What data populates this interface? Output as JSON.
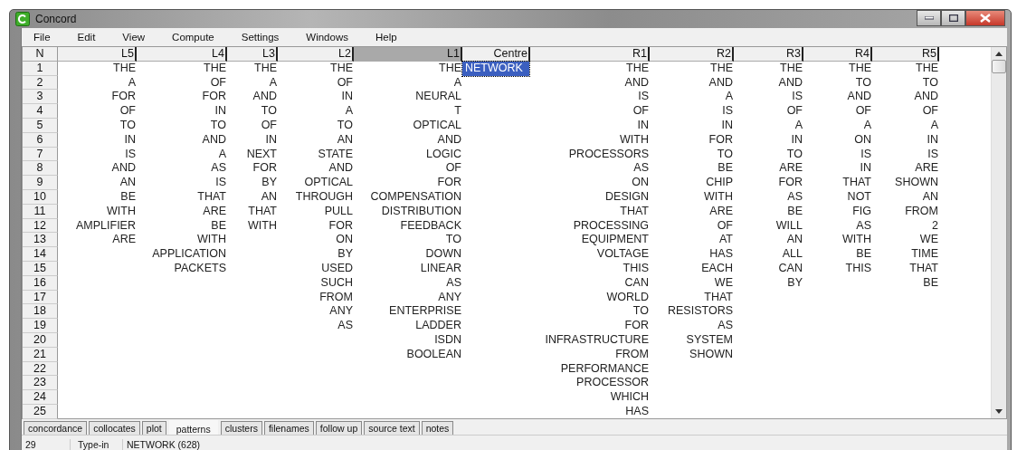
{
  "window": {
    "title": "Concord"
  },
  "menu": [
    "File",
    "Edit",
    "View",
    "Compute",
    "Settings",
    "Windows",
    "Help"
  ],
  "table": {
    "row_header": "N",
    "row_numbers": [
      "1",
      "2",
      "3",
      "4",
      "5",
      "6",
      "7",
      "8",
      "9",
      "10",
      "11",
      "12",
      "13",
      "14",
      "15",
      "16",
      "17",
      "18",
      "19",
      "20",
      "21",
      "22",
      "23",
      "24",
      "25"
    ],
    "columns": [
      {
        "label": "L5",
        "selected": false,
        "words": [
          "THE",
          "A",
          "FOR",
          "OF",
          "TO",
          "IN",
          "IS",
          "AND",
          "AN",
          "BE",
          "WITH",
          "AMPLIFIER",
          "ARE"
        ]
      },
      {
        "label": "L4",
        "selected": false,
        "words": [
          "THE",
          "OF",
          "FOR",
          "IN",
          "TO",
          "AND",
          "A",
          "AS",
          "IS",
          "THAT",
          "ARE",
          "BE",
          "WITH",
          "APPLICATION",
          "PACKETS"
        ]
      },
      {
        "label": "L3",
        "selected": false,
        "words": [
          "THE",
          "A",
          "AND",
          "TO",
          "OF",
          "IN",
          "NEXT",
          "FOR",
          "BY",
          "AN",
          "THAT",
          "WITH"
        ]
      },
      {
        "label": "L2",
        "selected": false,
        "words": [
          "THE",
          "OF",
          "IN",
          "A",
          "TO",
          "AN",
          "STATE",
          "AND",
          "OPTICAL",
          "THROUGH",
          "PULL",
          "FOR",
          "ON",
          "BY",
          "USED",
          "SUCH",
          "FROM",
          "ANY",
          "AS"
        ]
      },
      {
        "label": "L1",
        "selected": true,
        "words": [
          "THE",
          "A",
          "NEURAL",
          "T",
          "OPTICAL",
          "AND",
          "LOGIC",
          "OF",
          "FOR",
          "COMPENSATION",
          "DISTRIBUTION",
          "FEEDBACK",
          "TO",
          "DOWN",
          "LINEAR",
          "AS",
          "ANY",
          "ENTERPRISE",
          "LADDER",
          "ISDN",
          "BOOLEAN"
        ]
      },
      {
        "label": "Centre",
        "selected": false,
        "cells": [
          {
            "text": "NETWORK",
            "selected": true
          }
        ]
      },
      {
        "label": "R1",
        "selected": false,
        "words": [
          "THE",
          "AND",
          "IS",
          "OF",
          "IN",
          "WITH",
          "PROCESSORS",
          "AS",
          "ON",
          "DESIGN",
          "THAT",
          "PROCESSING",
          "EQUIPMENT",
          "VOLTAGE",
          "THIS",
          "CAN",
          "WORLD",
          "TO",
          "FOR",
          "INFRASTRUCTURE",
          "FROM",
          "PERFORMANCE",
          "PROCESSOR",
          "WHICH",
          "HAS"
        ]
      },
      {
        "label": "R2",
        "selected": false,
        "words": [
          "THE",
          "AND",
          "A",
          "IS",
          "IN",
          "FOR",
          "TO",
          "BE",
          "CHIP",
          "WITH",
          "ARE",
          "OF",
          "AT",
          "HAS",
          "EACH",
          "WE",
          "THAT",
          "RESISTORS",
          "AS",
          "SYSTEM",
          "SHOWN"
        ]
      },
      {
        "label": "R3",
        "selected": false,
        "words": [
          "THE",
          "AND",
          "IS",
          "OF",
          "A",
          "IN",
          "TO",
          "ARE",
          "FOR",
          "AS",
          "BE",
          "WILL",
          "AN",
          "ALL",
          "CAN",
          "BY"
        ]
      },
      {
        "label": "R4",
        "selected": false,
        "words": [
          "THE",
          "TO",
          "AND",
          "OF",
          "A",
          "ON",
          "IS",
          "IN",
          "THAT",
          "NOT",
          "FIG",
          "AS",
          "WITH",
          "BE",
          "THIS"
        ]
      },
      {
        "label": "R5",
        "selected": false,
        "words": [
          "THE",
          "TO",
          "AND",
          "OF",
          "A",
          "IN",
          "IS",
          "ARE",
          "SHOWN",
          "AN",
          "FROM",
          "2",
          "WE",
          "TIME",
          "THAT",
          "BE"
        ]
      }
    ]
  },
  "tabs": [
    {
      "label": "concordance",
      "selected": false
    },
    {
      "label": "collocates",
      "selected": false
    },
    {
      "label": "plot",
      "selected": false
    },
    {
      "label": "patterns",
      "selected": true
    },
    {
      "label": "clusters",
      "selected": false
    },
    {
      "label": "filenames",
      "selected": false
    },
    {
      "label": "follow up",
      "selected": false
    },
    {
      "label": "source text",
      "selected": false
    },
    {
      "label": "notes",
      "selected": false
    }
  ],
  "status_bar": [
    "29",
    "Type-in",
    "NETWORK (628)"
  ]
}
